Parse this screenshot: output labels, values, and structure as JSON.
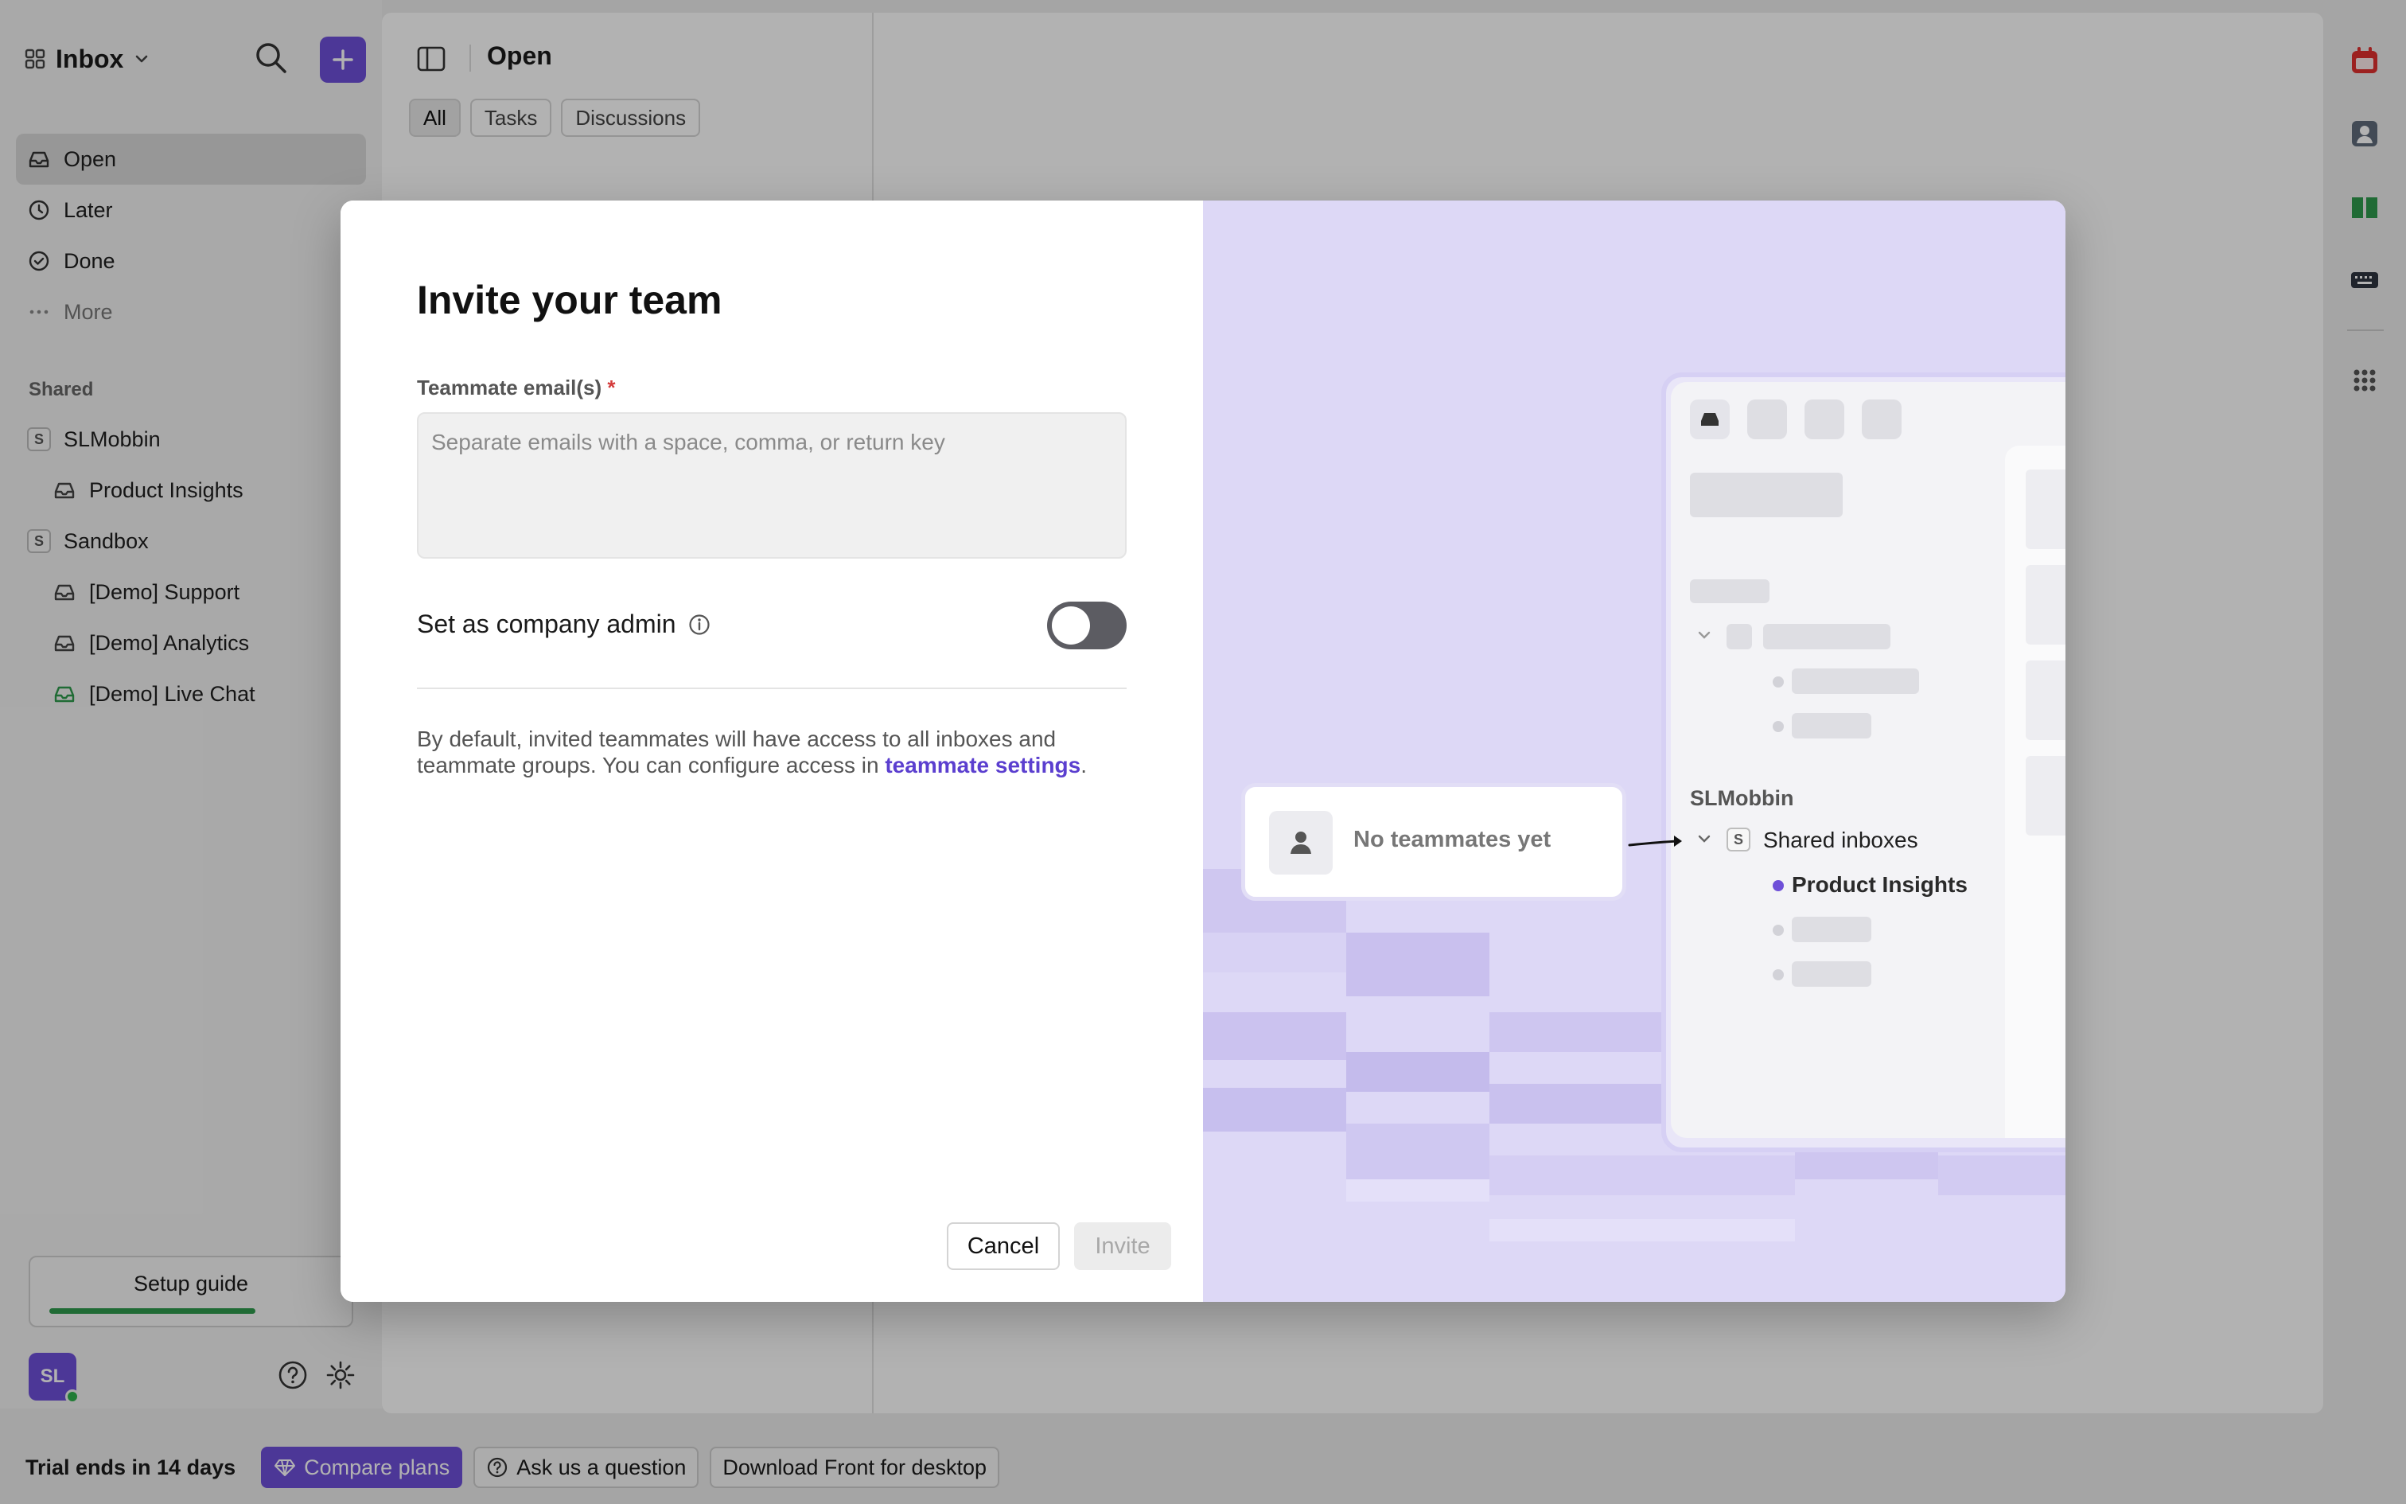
{
  "sidebar": {
    "title": "Inbox",
    "nav": [
      {
        "label": "Open",
        "icon": "inbox-icon"
      },
      {
        "label": "Later",
        "icon": "clock-icon"
      },
      {
        "label": "Done",
        "icon": "check-circle-icon"
      },
      {
        "label": "More",
        "icon": "ellipsis-icon"
      }
    ],
    "shared_heading": "Shared",
    "shared": [
      {
        "label": "SLMobbin",
        "badge": "S"
      },
      {
        "label": "Product Insights"
      },
      {
        "label": "Sandbox",
        "badge": "S"
      },
      {
        "label": "[Demo] Support"
      },
      {
        "label": "[Demo] Analytics"
      },
      {
        "label": "[Demo] Live Chat"
      }
    ],
    "setup_guide": "Setup guide",
    "setup_progress": 0.72,
    "avatar_initials": "SL"
  },
  "list_panel": {
    "title": "Open",
    "tabs": [
      "All",
      "Tasks",
      "Discussions"
    ],
    "active_tab": "All"
  },
  "bottom_bar": {
    "trial": "Trial ends in 14 days",
    "compare": "Compare plans",
    "ask": "Ask us a question",
    "download": "Download Front for desktop"
  },
  "modal": {
    "title": "Invite your team",
    "email_label": "Teammate email(s)",
    "required_mark": "*",
    "email_value": "",
    "email_placeholder": "Separate emails with a space, comma, or return key",
    "admin_label": "Set as company admin",
    "admin_enabled": false,
    "description_prefix": "By default, invited teammates will have access to all inboxes and teammate groups. You can configure access in ",
    "description_link": "teammate settings",
    "description_suffix": ".",
    "cancel": "Cancel",
    "invite": "Invite"
  },
  "illustration": {
    "no_teammates": "No teammates yet",
    "workspace": "SLMobbin",
    "group_badge": "S",
    "group": "Shared inboxes",
    "inbox": "Product Insights"
  },
  "colors": {
    "accent": "#6e4fd8",
    "illustration_bg": "#ddd8f6",
    "link": "#5b3fcf",
    "toggle_off": "#5c5c62"
  }
}
